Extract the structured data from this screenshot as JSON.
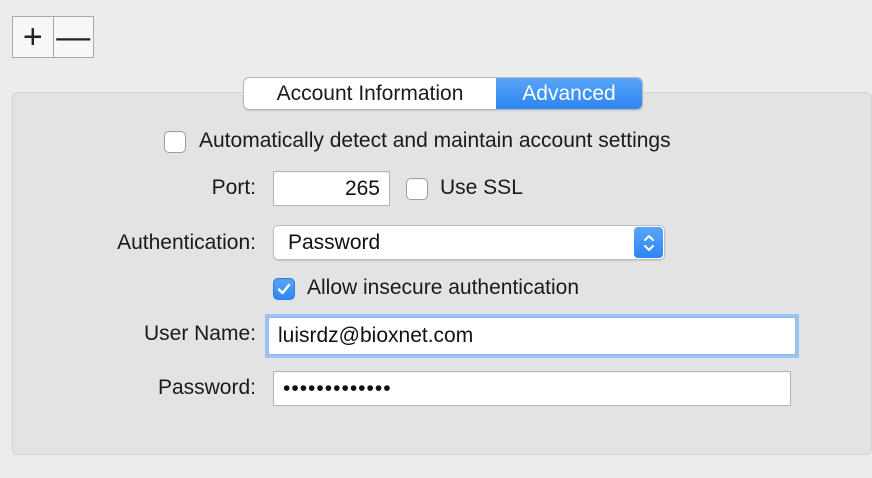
{
  "toolbar": {
    "add_label": "+",
    "remove_label": "—"
  },
  "tabs": [
    {
      "label": "Account Information",
      "selected": false
    },
    {
      "label": "Advanced",
      "selected": true
    }
  ],
  "auto_detect": {
    "label": "Automatically detect and maintain account settings",
    "checked": false
  },
  "port": {
    "label": "Port:",
    "value": "265"
  },
  "ssl": {
    "label": "Use SSL",
    "checked": false
  },
  "authentication": {
    "label": "Authentication:",
    "value": "Password"
  },
  "insecure": {
    "label": "Allow insecure authentication",
    "checked": true
  },
  "username": {
    "label": "User Name:",
    "value": "luisrdz@bioxnet.com"
  },
  "password": {
    "label": "Password:",
    "value": "•••••••••••••"
  },
  "colors": {
    "accent": "#2f87f2",
    "background": "#ececec",
    "group_box": "#e3e3e3"
  }
}
